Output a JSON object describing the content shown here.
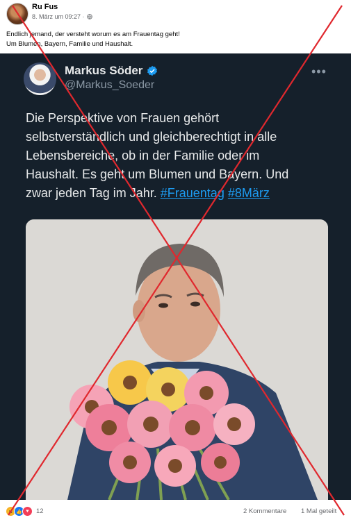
{
  "post": {
    "author": "Ru Fus",
    "timestamp": "8. März um 09:27 ·",
    "text_lines": [
      "Endlich jemand, der versteht worum es am Frauentag geht!",
      "Um Blumen, Bayern, Familie und Haushalt."
    ]
  },
  "tweet": {
    "name": "Markus Söder",
    "handle": "@Markus_Soeder",
    "more": "•••",
    "lines": [
      "Die Perspektive von Frauen gehört",
      "selbstverständlich und gleichberechtigt in alle",
      "Lebensbereiche, ob in der Familie oder im",
      "Haushalt. Es geht um Blumen und Bayern. Und"
    ],
    "last_line_prefix": "zwar jeden Tag im Jahr. ",
    "hashtags": [
      "#Frauentag",
      "#8März"
    ]
  },
  "footer": {
    "reaction_count": "12",
    "comments": "2 Kommentare",
    "shares": "1 Mal geteilt"
  },
  "colors": {
    "tweet_background": "#15202b",
    "hashtag": "#1d9bf0",
    "cross": "#e0282e"
  }
}
